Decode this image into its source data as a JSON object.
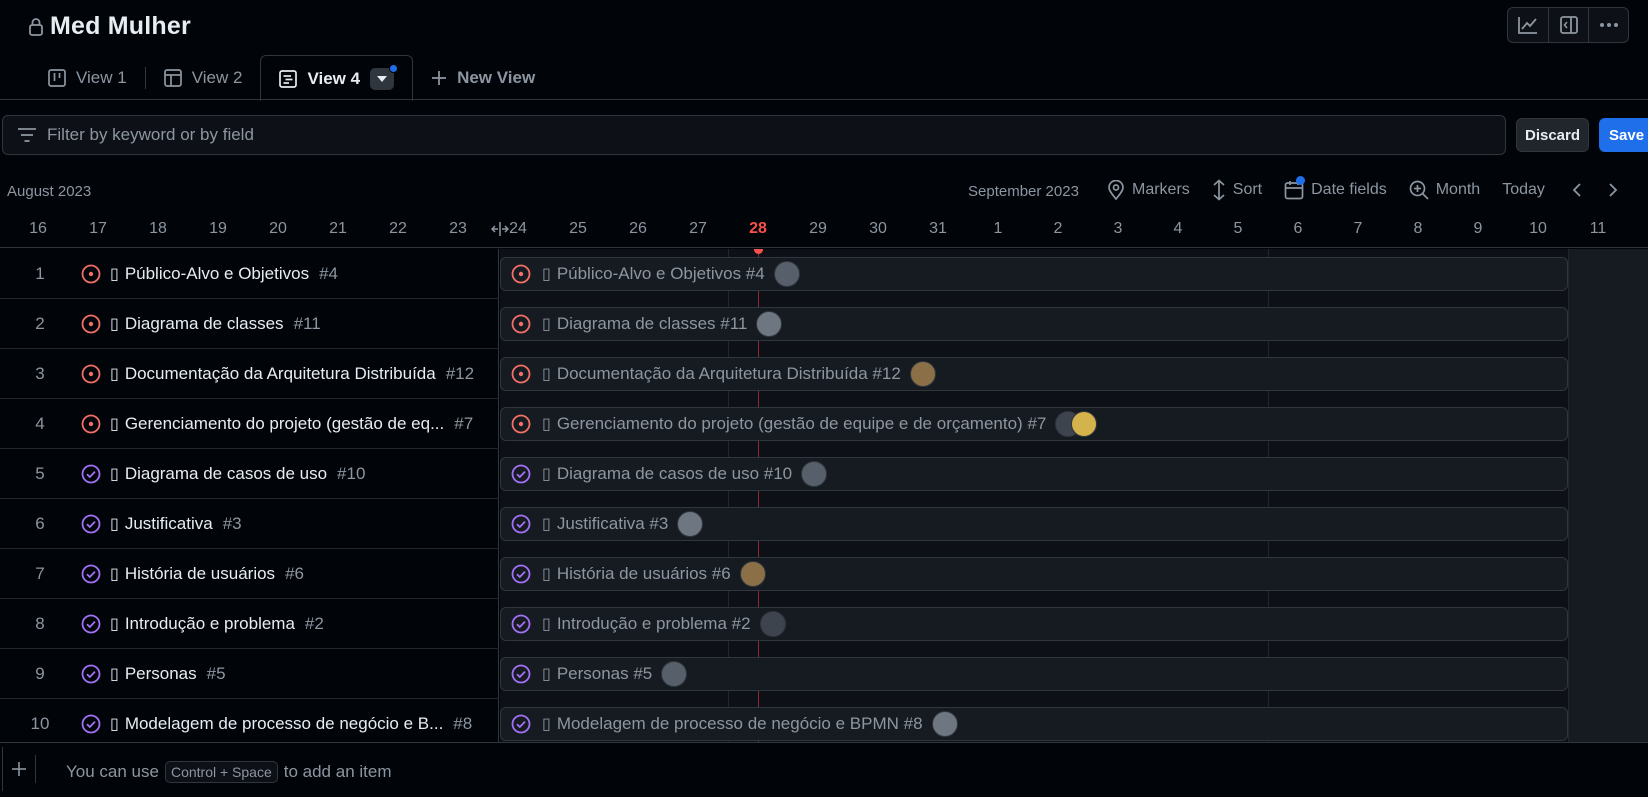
{
  "project": {
    "title": "Med Mulher"
  },
  "tabs": [
    {
      "label": "View 1",
      "icon": "board-icon"
    },
    {
      "label": "View 2",
      "icon": "table-icon"
    },
    {
      "label": "View 4",
      "icon": "roadmap-icon"
    }
  ],
  "new_view_label": "New View",
  "filter": {
    "placeholder": "Filter by keyword or by field"
  },
  "buttons": {
    "discard": "Discard",
    "save": "Save"
  },
  "timeline": {
    "month_left": "August 2023",
    "month_right": "September 2023",
    "controls": {
      "markers": "Markers",
      "sort": "Sort",
      "date_fields": "Date fields",
      "zoom": "Month",
      "today": "Today"
    },
    "dates": [
      "16",
      "17",
      "18",
      "19",
      "20",
      "21",
      "22",
      "23",
      "24",
      "25",
      "26",
      "27",
      "28",
      "29",
      "30",
      "31",
      "1",
      "2",
      "3",
      "4",
      "5",
      "6",
      "7",
      "8",
      "9",
      "10",
      "11"
    ],
    "today_date": "28"
  },
  "items": [
    {
      "num": "1",
      "status": "open",
      "title": "Público-Alvo e Objetivos",
      "issue": "#4",
      "bar": "Público-Alvo e Objetivos #4",
      "avatars": 1
    },
    {
      "num": "2",
      "status": "open",
      "title": "Diagrama de classes",
      "issue": "#11",
      "bar": "Diagrama de classes #11",
      "avatars": 1
    },
    {
      "num": "3",
      "status": "open",
      "title": "Documentação da Arquitetura Distribuída",
      "issue": "#12",
      "bar": "Documentação da Arquitetura Distribuída #12",
      "avatars": 1
    },
    {
      "num": "4",
      "status": "open",
      "title": "Gerenciamento do projeto (gestão de eq...",
      "issue": "#7",
      "bar": "Gerenciamento do projeto (gestão de equipe e de orçamento) #7",
      "avatars": 2
    },
    {
      "num": "5",
      "status": "done",
      "title": "Diagrama de casos de uso",
      "issue": "#10",
      "bar": "Diagrama de casos de uso #10",
      "avatars": 1
    },
    {
      "num": "6",
      "status": "done",
      "title": "Justificativa",
      "issue": "#3",
      "bar": "Justificativa #3",
      "avatars": 1
    },
    {
      "num": "7",
      "status": "done",
      "title": "História de usuários",
      "issue": "#6",
      "bar": "História de usuários #6",
      "avatars": 1
    },
    {
      "num": "8",
      "status": "done",
      "title": "Introdução e problema",
      "issue": "#2",
      "bar": "Introdução e problema #2",
      "avatars": 1
    },
    {
      "num": "9",
      "status": "done",
      "title": "Personas",
      "issue": "#5",
      "bar": "Personas #5",
      "avatars": 1
    },
    {
      "num": "10",
      "status": "done",
      "title": "Modelagem de processo de negócio e B...",
      "issue": "#8",
      "bar": "Modelagem de processo de negócio e BPMN #8",
      "avatars": 1
    }
  ],
  "footer": {
    "hint_before": "You can use",
    "shortcut": "Control + Space",
    "hint_after": "to add an item"
  },
  "colors": {
    "accent": "#1f6feb",
    "open": "#f47067",
    "done": "#a371f7",
    "today": "#f85149"
  }
}
